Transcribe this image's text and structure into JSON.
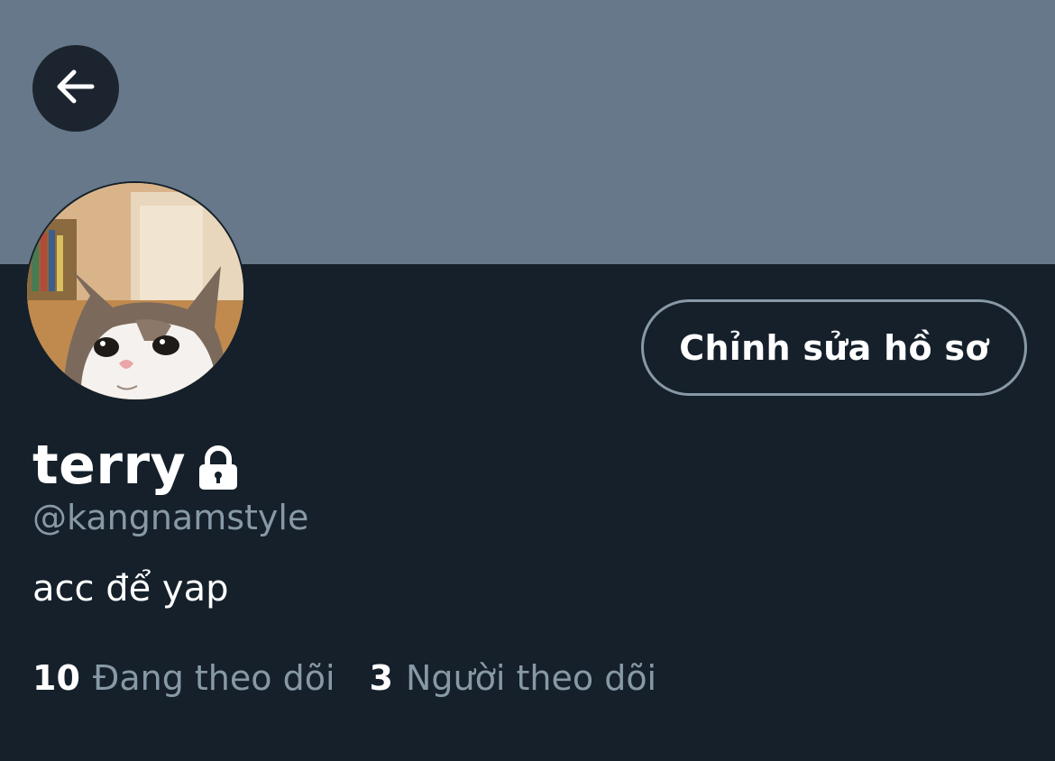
{
  "profile": {
    "display_name": "terry",
    "handle": "@kangnamstyle",
    "bio": "acc để yap",
    "edit_button_label": "Chỉnh sửa hồ sơ"
  },
  "stats": {
    "following_count": "10",
    "following_label": "Đang theo dõi",
    "followers_count": "3",
    "followers_label": "Người theo dõi"
  },
  "icons": {
    "back": "arrow-left-icon",
    "lock": "lock-icon"
  },
  "colors": {
    "background": "#15202b",
    "banner": "#66788a",
    "secondary_text": "#8899a6"
  }
}
